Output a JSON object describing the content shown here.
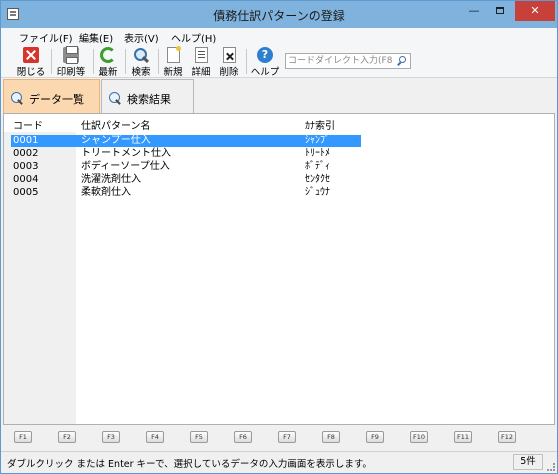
{
  "window": {
    "title": "債務仕訳パターンの登録"
  },
  "menu": {
    "items": [
      {
        "label": "ファイル(F)"
      },
      {
        "label": "編集(E)"
      },
      {
        "label": "表示(V)"
      },
      {
        "label": "ヘルプ(H)"
      }
    ]
  },
  "toolbar": {
    "close_label": "閉じる",
    "print_label": "印刷等",
    "refresh_label": "最新",
    "search_label": "検索",
    "new_label": "新規",
    "detail_label": "詳細",
    "delete_label": "削除",
    "help_label": "ヘルプ",
    "direct_input_placeholder": "コードダイレクト入力(F8)"
  },
  "tabs": [
    {
      "label": "データ一覧",
      "active": true
    },
    {
      "label": "検索結果",
      "active": false
    }
  ],
  "table": {
    "headers": [
      "コード",
      "仕訳パターン名",
      "ｶﾅ索引"
    ],
    "rows": [
      {
        "code": "0001",
        "name": "シャンプー仕入",
        "kana": "ｼｬﾝﾌﾟ"
      },
      {
        "code": "0002",
        "name": "トリートメント仕入",
        "kana": "ﾄﾘｰﾄﾒ"
      },
      {
        "code": "0003",
        "name": "ボディーソープ仕入",
        "kana": "ﾎﾞﾃﾞｨ"
      },
      {
        "code": "0004",
        "name": "洗濯洗剤仕入",
        "kana": "ｾﾝﾀｸｾ"
      },
      {
        "code": "0005",
        "name": "柔軟剤仕入",
        "kana": "ｼﾞｭｳﾅ"
      }
    ],
    "selected_row": 0
  },
  "fkeys": [
    "F1",
    "F2",
    "F3",
    "F4",
    "F5",
    "F6",
    "F7",
    "F8",
    "F9",
    "F10",
    "F11",
    "F12"
  ],
  "status": {
    "message": "ダブルクリック または Enter キーで、選択しているデータの入力画面を表示します。",
    "count": "5件"
  },
  "colors": {
    "titlebar": "#7fb2dd",
    "close_button": "#c7403a",
    "active_tab": "#fbd8b0",
    "selection": "#3399ff"
  }
}
